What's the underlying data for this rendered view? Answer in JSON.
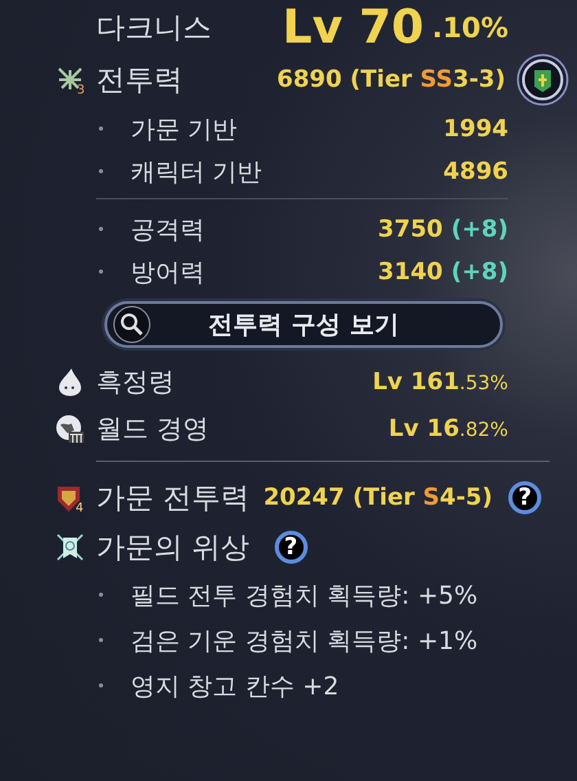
{
  "character": {
    "name": "다크니스",
    "level": "Lv 70",
    "level_fraction": ".10%"
  },
  "combat_power": {
    "label": "전투력",
    "icon_badge": "3",
    "value": "6890",
    "tier_label": "(Tier",
    "grade": "SS",
    "grade_rest": "3-3)"
  },
  "base_rows": [
    {
      "label": "가문 기반",
      "value": "1994"
    },
    {
      "label": "캐릭터 기반",
      "value": "4896"
    }
  ],
  "stat_rows": [
    {
      "label": "공격력",
      "value": "3750",
      "bonus": "(+8)"
    },
    {
      "label": "방어력",
      "value": "3140",
      "bonus": "(+8)"
    }
  ],
  "breakdown_button": {
    "label": "전투력 구성 보기"
  },
  "level_rows": [
    {
      "kind": "spirit",
      "label": "흑정령",
      "level": "Lv 161",
      "fraction": ".53%"
    },
    {
      "kind": "world",
      "label": "월드 경영",
      "level": "Lv 16",
      "fraction": ".82%"
    }
  ],
  "family_power": {
    "label": "가문 전투력",
    "icon_badge": "4",
    "value": "20247",
    "tier_label": "(Tier",
    "grade": "S",
    "grade_rest": "4-5)",
    "help": "?"
  },
  "family_prestige": {
    "label": "가문의 위상",
    "help": "?",
    "bonuses": [
      "필드 전투 경험치 획득량: +5%",
      "검은 기운 경험치 획득량: +1%",
      "영지 창고 칸수 +2"
    ]
  }
}
